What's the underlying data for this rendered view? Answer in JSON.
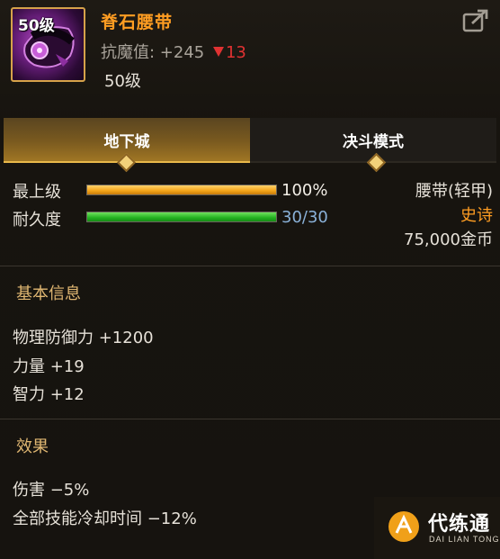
{
  "item": {
    "level_badge": "50级",
    "name": "脊石腰带",
    "antimagic_text": "抗魔值: +245",
    "antimagic_delta": "13",
    "required_level": "50级",
    "slot_type": "腰带(轻甲)",
    "rarity": "史诗",
    "price": "75,000金币",
    "name_color": "#ff9d22",
    "rarity_color": "#ff9d22",
    "delta_color": "#e03232"
  },
  "tabs": [
    {
      "label": "地下城",
      "active": true
    },
    {
      "label": "决斗模式",
      "active": false
    }
  ],
  "stats": {
    "upgrade": {
      "label": "最上级",
      "value_text": "100%",
      "fraction": 1.0
    },
    "durability": {
      "label": "耐久度",
      "value_text": "30/30",
      "fraction": 1.0
    }
  },
  "basic_info": {
    "title": "基本信息",
    "lines": [
      "物理防御力 +1200",
      "力量 +19",
      "智力 +12"
    ]
  },
  "effects": {
    "title": "效果",
    "lines": [
      "伤害 −5%",
      "全部技能冷却时间 −12%"
    ]
  },
  "watermark": {
    "title": "代练通",
    "subtitle": "DAI LIAN TONG"
  },
  "icons": {
    "share": "share-export-icon",
    "item": "belt-item-icon",
    "logo": "dailiantong-logo-icon"
  }
}
